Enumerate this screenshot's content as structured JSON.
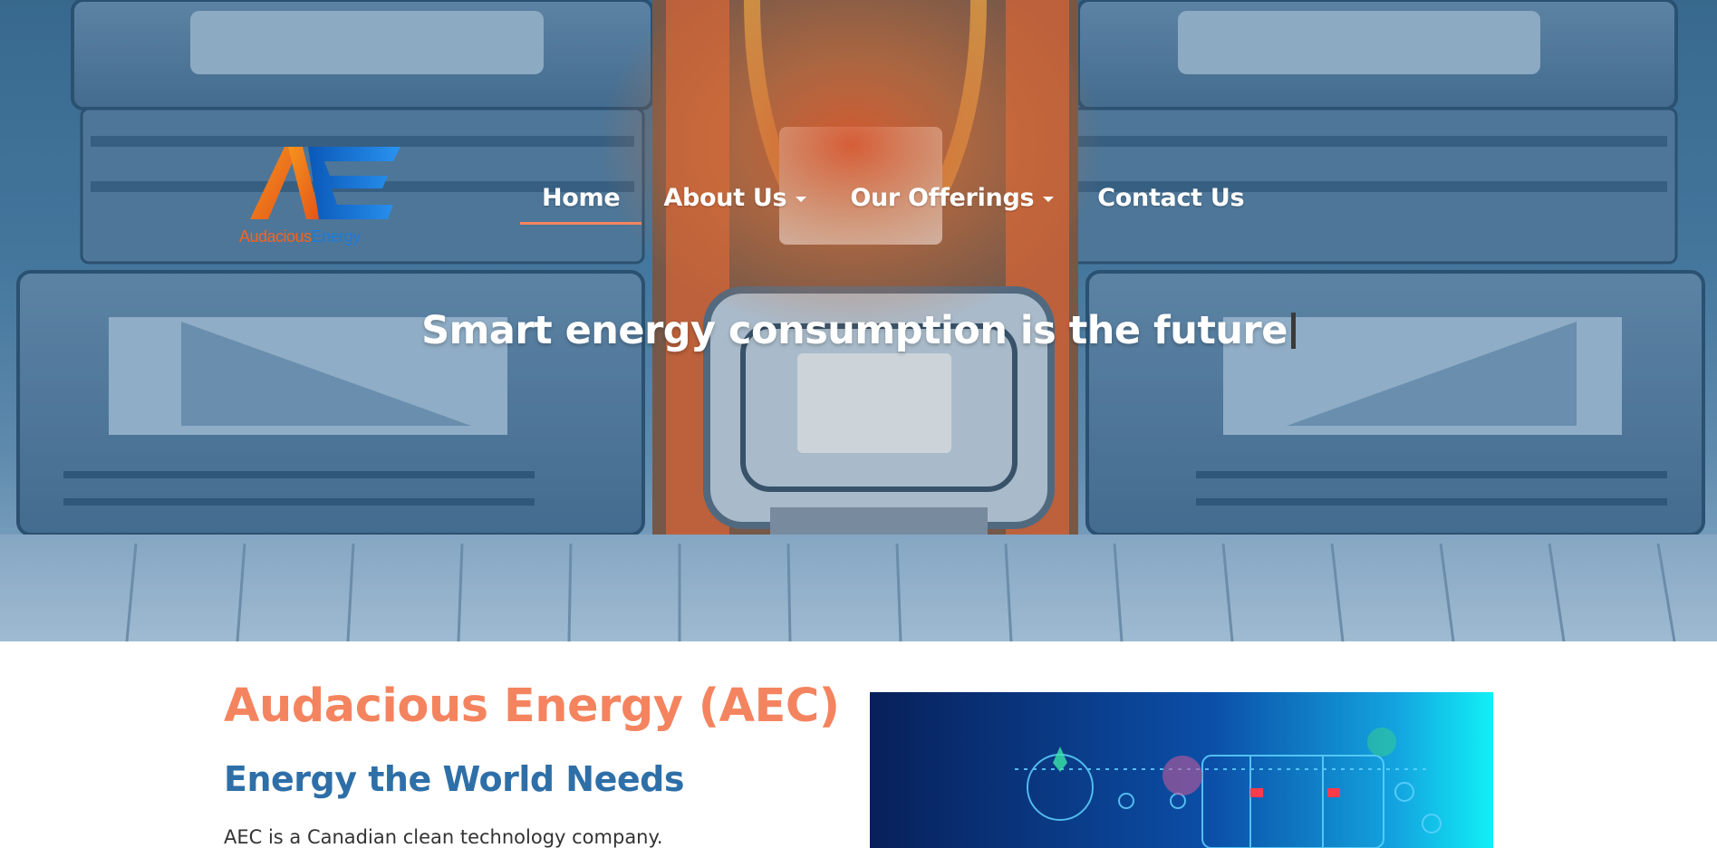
{
  "brand": {
    "logo_name_part1": "Audacious",
    "logo_name_part2": "Energy"
  },
  "nav": {
    "home": "Home",
    "about": "About Us",
    "offerings": "Our Offerings",
    "contact": "Contact Us"
  },
  "hero": {
    "headline": "Smart energy consumption is the future"
  },
  "intro": {
    "title": "Audacious Energy (AEC)",
    "subtitle": "Energy the World Needs",
    "body": "AEC is a Canadian clean technology company."
  },
  "colors": {
    "accent_orange": "#f4845f",
    "brand_blue": "#2e6fa8",
    "logo_orange": "#f26522",
    "logo_blue": "#1d7bd6"
  },
  "icons": {
    "dropdown": "chevron-down-icon"
  }
}
